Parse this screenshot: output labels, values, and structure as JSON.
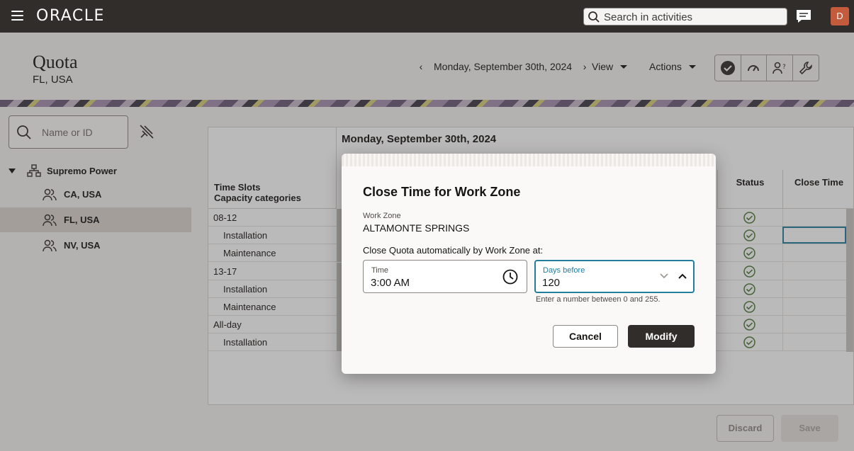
{
  "header": {
    "logo": "ORACLE",
    "search_placeholder": "Search in activities",
    "avatar_initial": "D"
  },
  "titlebar": {
    "title": "Quota",
    "subtitle": "FL, USA",
    "date": "Monday, September 30th, 2024",
    "view_label": "View",
    "actions_label": "Actions"
  },
  "sidebar": {
    "filter_placeholder": "Name or ID",
    "root": "Supremo Power",
    "items": [
      {
        "label": "CA, USA"
      },
      {
        "label": "FL, USA"
      },
      {
        "label": "NV, USA"
      }
    ]
  },
  "table": {
    "header_line1": "Time Slots",
    "header_line2": "Capacity categories",
    "date_heading": "Monday, September 30th, 2024",
    "status_header": "Status",
    "close_time_header": "Close Time",
    "rows": [
      {
        "label": "08-12",
        "indent": false
      },
      {
        "label": "Installation",
        "indent": true
      },
      {
        "label": "Maintenance",
        "indent": true
      },
      {
        "label": "13-17",
        "indent": false
      },
      {
        "label": "Installation",
        "indent": true
      },
      {
        "label": "Maintenance",
        "indent": true
      },
      {
        "label": "All-day",
        "indent": false
      },
      {
        "label": "Installation",
        "indent": true
      }
    ]
  },
  "footer": {
    "discard_label": "Discard",
    "save_label": "Save"
  },
  "dialog": {
    "title": "Close Time for Work Zone",
    "work_zone_caption": "Work Zone",
    "work_zone_value": "ALTAMONTE SPRINGS",
    "instruction": "Close Quota automatically by Work Zone at:",
    "time_caption": "Time",
    "time_value": "3:00 AM",
    "days_caption": "Days before",
    "days_value": "120",
    "hint": "Enter a number between 0 and 255.",
    "cancel_label": "Cancel",
    "modify_label": "Modify"
  },
  "colors": {
    "topbar": "#312d2a",
    "accent": "#227e9e",
    "status_ok": "#4b7a3a",
    "avatar": "#c35b3c"
  }
}
